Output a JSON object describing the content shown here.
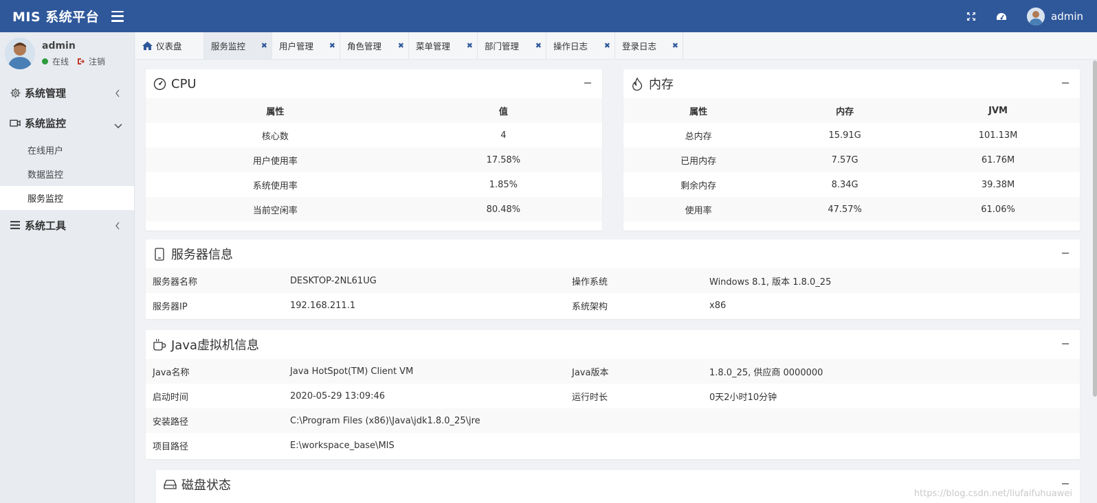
{
  "topbar": {
    "brand": "MIS 系统平台",
    "user_name": "admin"
  },
  "sidebar": {
    "user_name": "admin",
    "status_online": "在线",
    "logout": "注销",
    "menus": [
      {
        "label": "系统管理"
      },
      {
        "label": "系统监控",
        "children": [
          "在线用户",
          "数据监控",
          "服务监控"
        ]
      },
      {
        "label": "系统工具"
      }
    ]
  },
  "tabs": [
    "仪表盘",
    "服务监控",
    "用户管理",
    "角色管理",
    "菜单管理",
    "部门管理",
    "操作日志",
    "登录日志"
  ],
  "cpu": {
    "title": "CPU",
    "headers": [
      "属性",
      "值"
    ],
    "rows": [
      [
        "核心数",
        "4"
      ],
      [
        "用户使用率",
        "17.58%"
      ],
      [
        "系统使用率",
        "1.85%"
      ],
      [
        "当前空闲率",
        "80.48%"
      ]
    ]
  },
  "memory": {
    "title": "内存",
    "headers": [
      "属性",
      "内存",
      "JVM"
    ],
    "rows": [
      [
        "总内存",
        "15.91G",
        "101.13M"
      ],
      [
        "已用内存",
        "7.57G",
        "61.76M"
      ],
      [
        "剩余内存",
        "8.34G",
        "39.38M"
      ],
      [
        "使用率",
        "47.57%",
        "61.06%"
      ]
    ]
  },
  "server": {
    "title": "服务器信息",
    "rows": [
      [
        "服务器名称",
        "DESKTOP-2NL61UG",
        "操作系统",
        "Windows 8.1, 版本 1.8.0_25"
      ],
      [
        "服务器IP",
        "192.168.211.1",
        "系统架构",
        "x86"
      ]
    ]
  },
  "jvm": {
    "title": "Java虚拟机信息",
    "rows": [
      [
        "Java名称",
        "Java HotSpot(TM) Client VM",
        "Java版本",
        "1.8.0_25, 供应商 0000000"
      ],
      [
        "启动时间",
        "2020-05-29 13:09:46",
        "运行时长",
        "0天2小时10分钟"
      ],
      [
        "安装路径",
        "C:\\Program Files (x86)\\Java\\jdk1.8.0_25\\jre",
        "",
        ""
      ],
      [
        "项目路径",
        "E:\\workspace_base\\MIS",
        "",
        ""
      ]
    ]
  },
  "disk": {
    "title": "磁盘状态"
  },
  "watermark": "https://blog.csdn.net/liufaifuhuawei",
  "colors": {
    "topbar": "#2f589b",
    "online": "#2e9b3e",
    "logout": "#c0392b",
    "tab_close": "#2f589b"
  }
}
